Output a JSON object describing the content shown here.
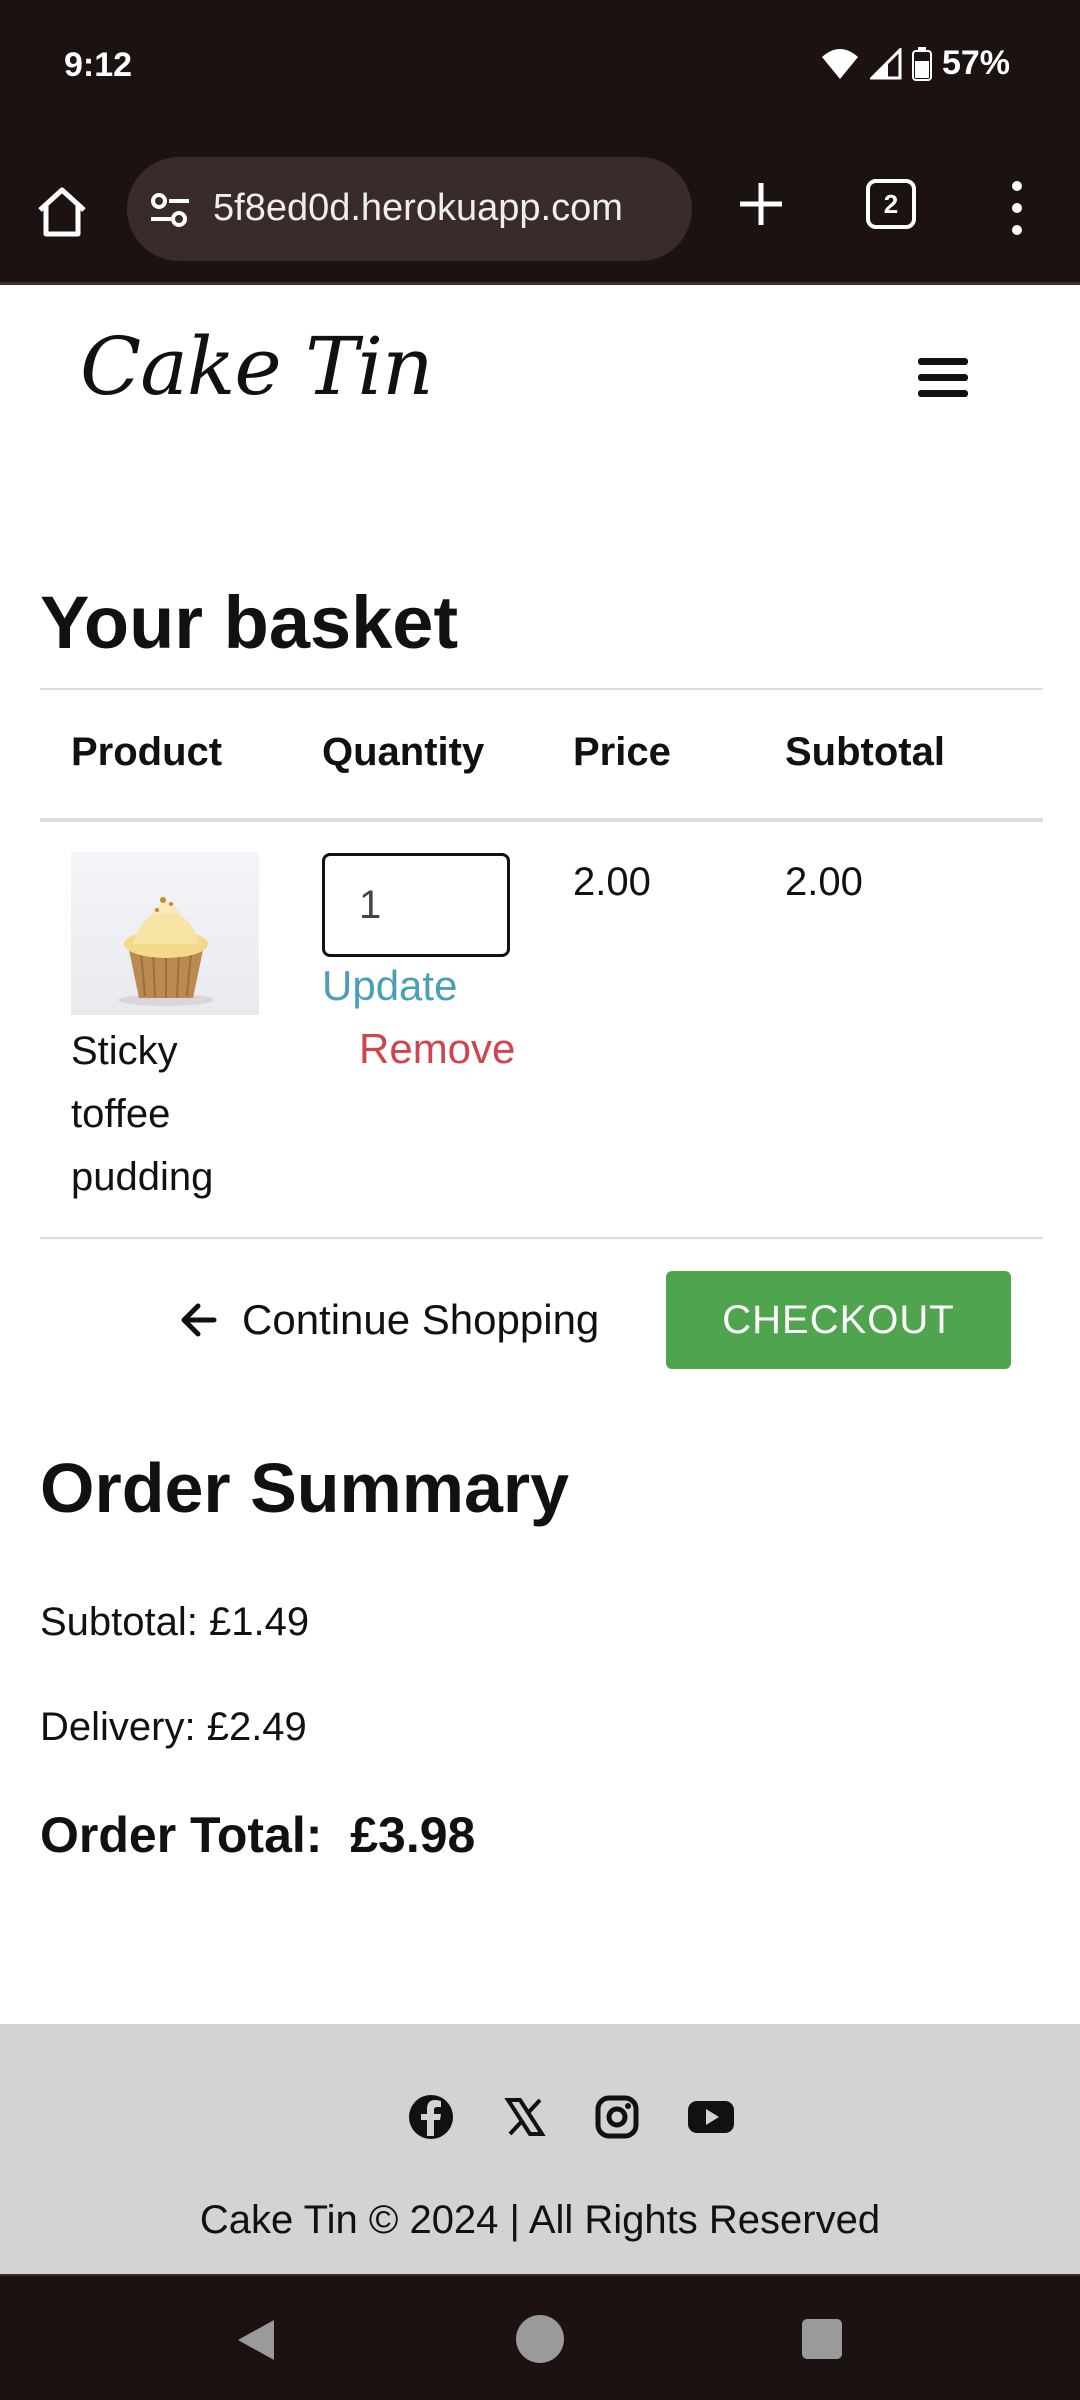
{
  "status_bar": {
    "time": "9:12",
    "battery": "57%"
  },
  "browser": {
    "url": "5f8ed0d.herokuapp.com",
    "tab_count": "2"
  },
  "site": {
    "logo": "Cake Tin"
  },
  "basket": {
    "title": "Your basket",
    "headers": {
      "product": "Product",
      "quantity": "Quantity",
      "price": "Price",
      "subtotal": "Subtotal"
    },
    "items": [
      {
        "name": "Sticky toffee pudding",
        "quantity": "1",
        "price": "2.00",
        "subtotal": "2.00",
        "update": "Update",
        "remove": "Remove"
      }
    ],
    "continue_label": "Continue Shopping",
    "checkout_label": "CHECKOUT"
  },
  "summary": {
    "title": "Order Summary",
    "subtotal": "Subtotal: £1.49",
    "delivery": "Delivery: £2.49",
    "total": "Order Total:  £3.98"
  },
  "footer": {
    "icons": [
      "facebook-icon",
      "x-icon",
      "instagram-icon",
      "youtube-icon"
    ],
    "copyright": "Cake Tin © 2024 | All Rights Reserved"
  },
  "colors": {
    "checkout": "#4ea54e",
    "update": "#4b9fb5",
    "remove": "#d0454c",
    "chrome": "#1c1212"
  }
}
